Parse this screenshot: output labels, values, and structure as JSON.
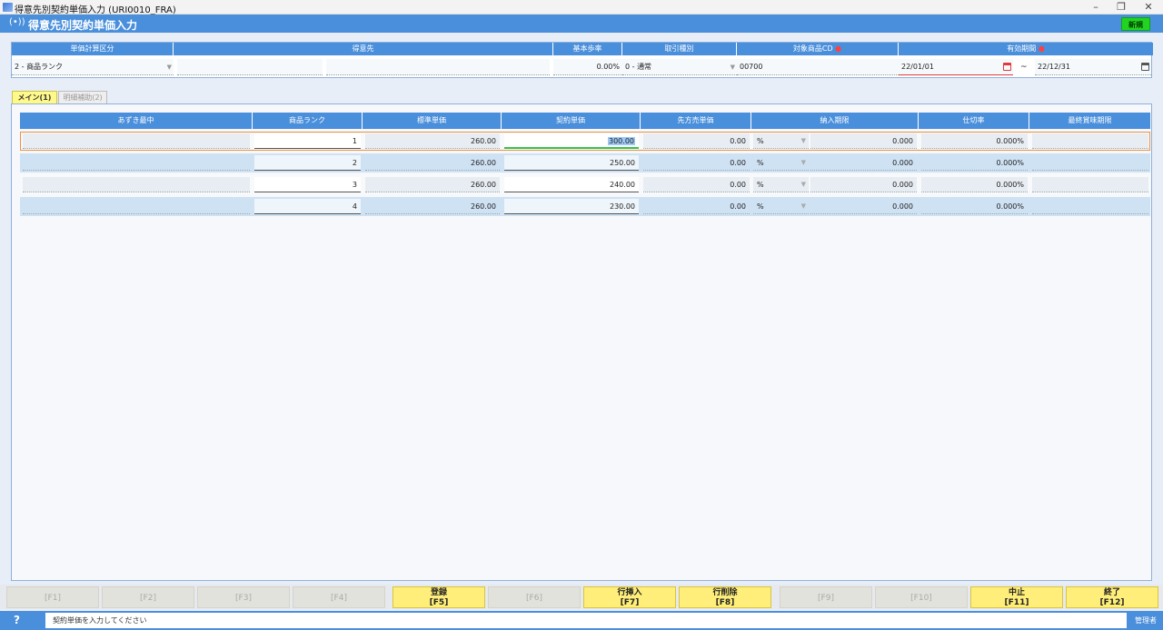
{
  "window": {
    "title": "得意先別契約単価入力 (URI0010_FRA)",
    "minimize": "–",
    "restore": "❐",
    "close": "✕"
  },
  "header": {
    "title": "得意先別契約単価入力",
    "mode": "新規",
    "signal_glyph": "(•))"
  },
  "criteria": {
    "headers": {
      "calc_type": "単価計算区分",
      "customer": "得意先",
      "base_rate": "基本歩率",
      "trade_type": "取引種別",
      "target_code": "対象商品CD",
      "valid_period": "有効期間",
      "required_mark": "●"
    },
    "values": {
      "calc_type": "2 - 商品ランク",
      "customer_code": "",
      "customer_name": "",
      "base_rate": "0.00%",
      "trade_type": "0 - 通常",
      "target_code": "00700",
      "valid_from": "22/01/01",
      "valid_to": "22/12/31",
      "tilde": "~"
    }
  },
  "tabs": [
    {
      "label": "メイン(1)"
    },
    {
      "label": "明細補助(2)"
    }
  ],
  "grid": {
    "columns": [
      "あずき最中",
      "商品ランク",
      "標準単価",
      "契約単価",
      "先方売単価",
      "納入期限",
      "仕切率",
      "最終賞味期限"
    ],
    "rows": [
      {
        "name": "",
        "rank": "1",
        "std_price": "260.00",
        "contract_price": "300.00",
        "dest_price": "0.00",
        "unit": "%",
        "deadline": "0.000",
        "rate": "0.000%",
        "expiry": ""
      },
      {
        "name": "",
        "rank": "2",
        "std_price": "260.00",
        "contract_price": "250.00",
        "dest_price": "0.00",
        "unit": "%",
        "deadline": "0.000",
        "rate": "0.000%",
        "expiry": ""
      },
      {
        "name": "",
        "rank": "3",
        "std_price": "260.00",
        "contract_price": "240.00",
        "dest_price": "0.00",
        "unit": "%",
        "deadline": "0.000",
        "rate": "0.000%",
        "expiry": ""
      },
      {
        "name": "",
        "rank": "4",
        "std_price": "260.00",
        "contract_price": "230.00",
        "dest_price": "0.00",
        "unit": "%",
        "deadline": "0.000",
        "rate": "0.000%",
        "expiry": ""
      }
    ]
  },
  "fkeys": [
    {
      "label": "",
      "key": "[F1]"
    },
    {
      "label": "",
      "key": "[F2]"
    },
    {
      "label": "",
      "key": "[F3]"
    },
    {
      "label": "",
      "key": "[F4]"
    },
    {
      "label": "登録",
      "key": "[F5]"
    },
    {
      "label": "",
      "key": "[F6]"
    },
    {
      "label": "行挿入",
      "key": "[F7]"
    },
    {
      "label": "行削除",
      "key": "[F8]"
    },
    {
      "label": "",
      "key": "[F9]"
    },
    {
      "label": "",
      "key": "[F10]"
    },
    {
      "label": "中止",
      "key": "[F11]"
    },
    {
      "label": "終了",
      "key": "[F12]"
    }
  ],
  "status": {
    "help": "?",
    "message": "契約単価を入力してください",
    "user": "管理者"
  }
}
